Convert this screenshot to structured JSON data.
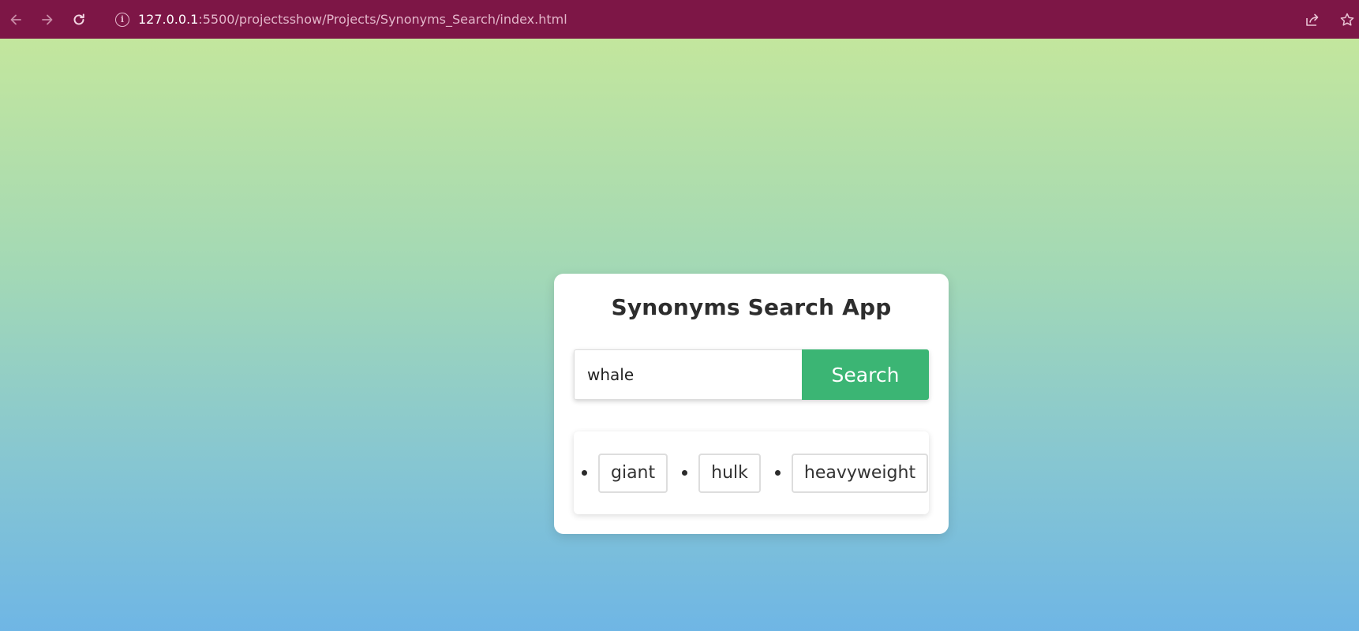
{
  "browser": {
    "url_host": "127.0.0.1",
    "url_path": ":5500/projectsshow/Projects/Synonyms_Search/index.html",
    "toolbar_color": "#7d1646",
    "icons": [
      "back-arrow-icon",
      "forward-arrow-icon",
      "reload-icon",
      "info-icon",
      "share-icon",
      "star-icon"
    ]
  },
  "app": {
    "title": "Synonyms Search App",
    "search": {
      "value": "whale",
      "placeholder": ""
    },
    "search_button_label": "Search",
    "accent_color": "#3bb574",
    "synonyms": [
      "giant",
      "hulk",
      "heavyweight"
    ]
  }
}
